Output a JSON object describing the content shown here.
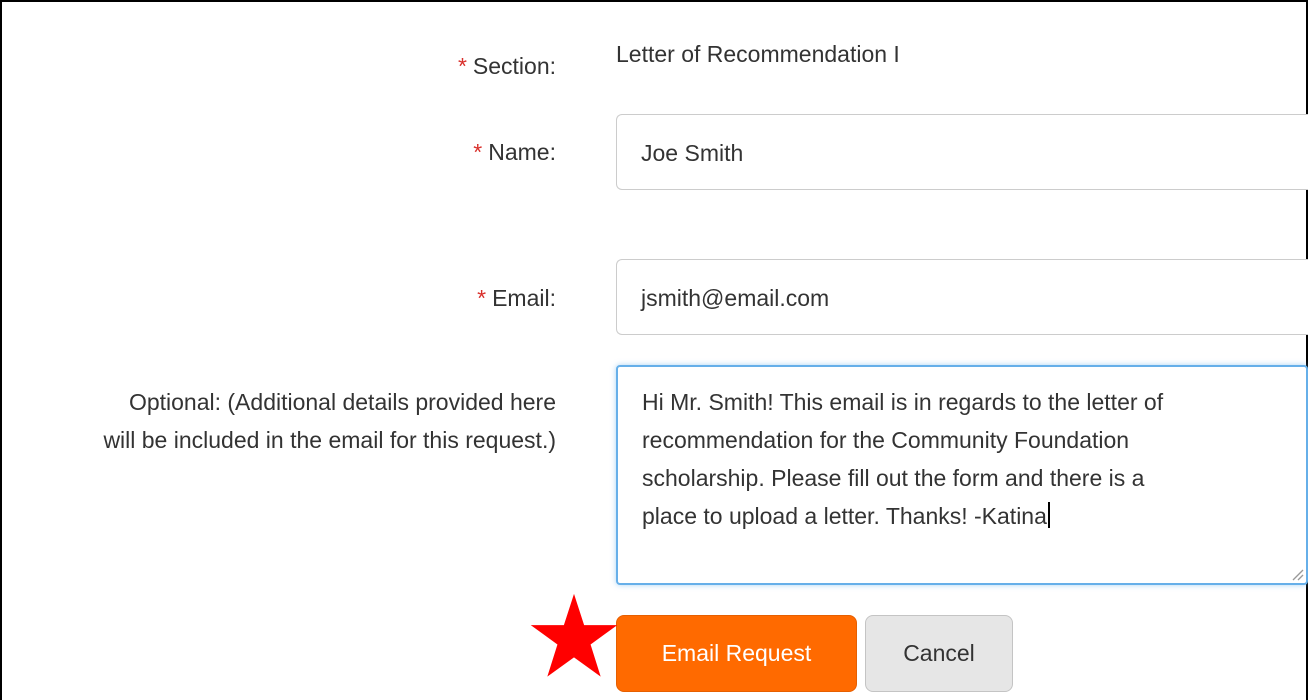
{
  "form": {
    "required_marker": "*",
    "section": {
      "label": "Section:",
      "value": "Letter of Recommendation I"
    },
    "name": {
      "label": "Name:",
      "value": "Joe Smith"
    },
    "email": {
      "label": "Email:",
      "value": "jsmith@email.com"
    },
    "optional": {
      "label_line1": "Optional: (Additional details provided here",
      "label_line2": "will be included in the email for this request.)",
      "value_lines": [
        "Hi Mr. Smith! This email is in regards to the letter of",
        "recommendation for the Community Foundation",
        "scholarship. Please fill out the form and there is a",
        "place to upload a letter. Thanks! -Katina"
      ]
    }
  },
  "buttons": {
    "email_request": "Email Request",
    "cancel": "Cancel"
  },
  "colors": {
    "primary": "#ff6a00",
    "required": "#d9302c",
    "focus_border": "#66afe9",
    "annotation_star": "#ff0000"
  },
  "icons": {
    "annotation": "star-icon",
    "resize": "resize-grip-icon"
  }
}
